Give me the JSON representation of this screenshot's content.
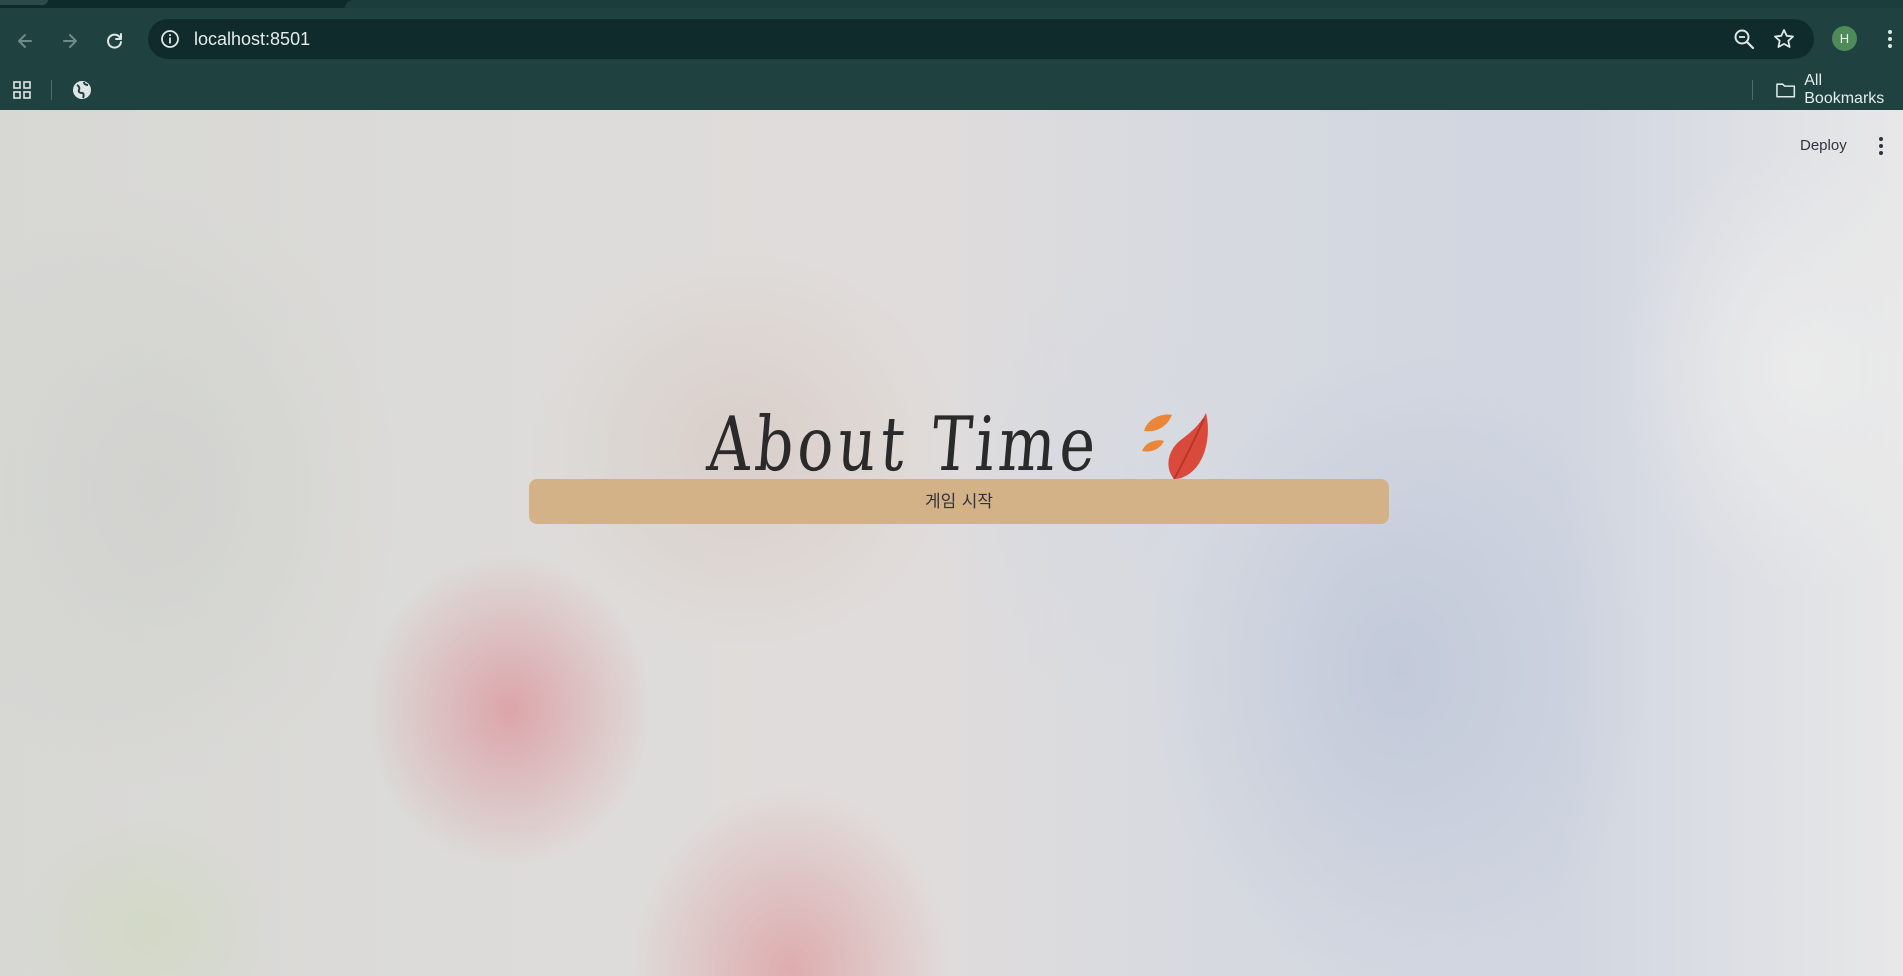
{
  "browser": {
    "url": "localhost:8501",
    "profile_initial": "H",
    "bookmarks_bar": {
      "all_bookmarks_label": "All Bookmarks"
    }
  },
  "app": {
    "deploy_label": "Deploy",
    "title": "About Time",
    "title_icon": "falling-leaves-icon",
    "start_button_label": "게임 시작"
  },
  "colors": {
    "chrome_bg": "#1f4140",
    "omnibox_bg": "#102b2b",
    "button_bg": "#d3b288",
    "title_text": "#2a2a2a",
    "avatar_bg": "#4f8a5b"
  }
}
